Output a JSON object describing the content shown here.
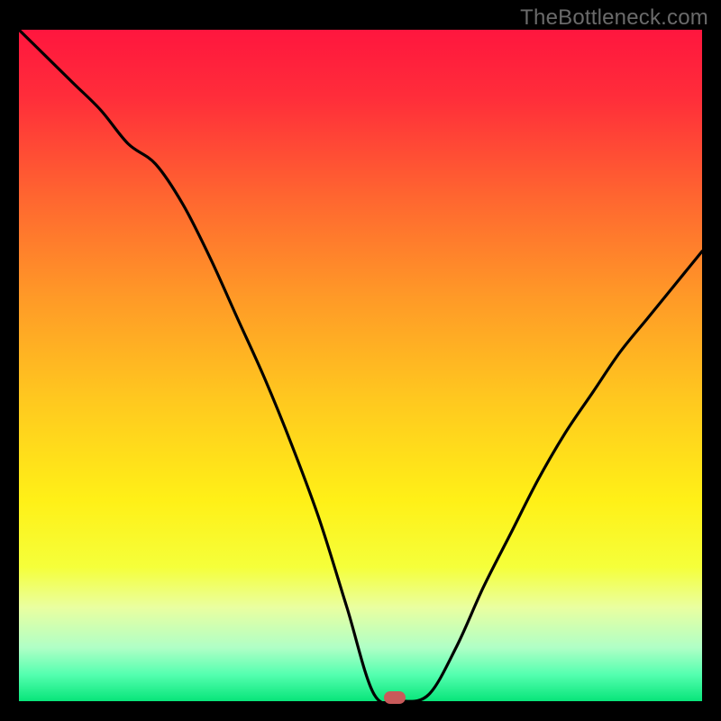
{
  "watermark": "TheBottleneck.com",
  "chart_data": {
    "type": "line",
    "title": "",
    "xlabel": "",
    "ylabel": "",
    "xlim": [
      0,
      100
    ],
    "ylim": [
      0,
      100
    ],
    "background_gradient": {
      "stops": [
        {
          "pos": 0.0,
          "color": "#ff163e"
        },
        {
          "pos": 0.1,
          "color": "#ff2d3a"
        },
        {
          "pos": 0.25,
          "color": "#ff6630"
        },
        {
          "pos": 0.4,
          "color": "#ff9a27"
        },
        {
          "pos": 0.55,
          "color": "#ffc81f"
        },
        {
          "pos": 0.7,
          "color": "#fff017"
        },
        {
          "pos": 0.8,
          "color": "#f5ff3a"
        },
        {
          "pos": 0.86,
          "color": "#eaffa0"
        },
        {
          "pos": 0.92,
          "color": "#b0ffc6"
        },
        {
          "pos": 0.96,
          "color": "#55ffb0"
        },
        {
          "pos": 1.0,
          "color": "#08e57a"
        }
      ],
      "description": "Vertical gradient from red (high bottleneck) to green (no bottleneck)."
    },
    "series": [
      {
        "name": "bottleneck-curve",
        "note": "Non-monotonic V-shaped curve. High at both x extremes, reaching ~0 near x≈52-58.",
        "x": [
          0,
          4,
          8,
          12,
          16,
          20,
          24,
          28,
          32,
          36,
          40,
          44,
          48,
          52,
          56,
          60,
          64,
          68,
          72,
          76,
          80,
          84,
          88,
          92,
          96,
          100
        ],
        "y": [
          100,
          96,
          92,
          88,
          83,
          80,
          74,
          66,
          57,
          48,
          38,
          27,
          14,
          1,
          0,
          1,
          8,
          17,
          25,
          33,
          40,
          46,
          52,
          57,
          62,
          67
        ]
      }
    ],
    "marker": {
      "x": 55,
      "y": 0.5,
      "color": "#c85a5a",
      "shape": "rounded-rect"
    }
  }
}
